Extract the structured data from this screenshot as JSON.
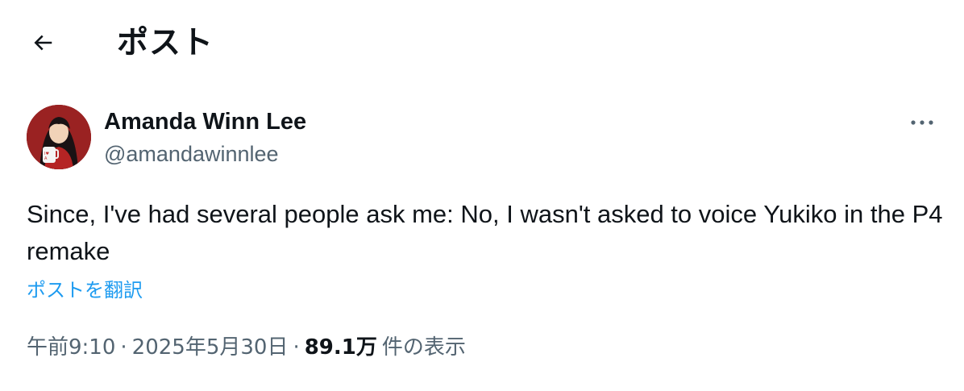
{
  "header": {
    "back_icon": "arrow-left-icon",
    "title": "ポスト"
  },
  "post": {
    "author": {
      "display_name": "Amanda Winn Lee",
      "handle": "@amandawinnlee",
      "avatar": "avatar-anime-character"
    },
    "more_icon": "more-horizontal-icon",
    "text": "Since, I've had several people ask me: No, I wasn't asked to voice Yukiko in the P4 remake",
    "translate_label": "ポストを翻訳",
    "meta": {
      "time": "午前9:10",
      "separator": "·",
      "date": "2025年5月30日",
      "views_count": "89.1万",
      "views_label": "件の表示"
    }
  },
  "colors": {
    "text_primary": "#0f1419",
    "text_secondary": "#536471",
    "link": "#1d9bf0",
    "background": "#ffffff"
  }
}
